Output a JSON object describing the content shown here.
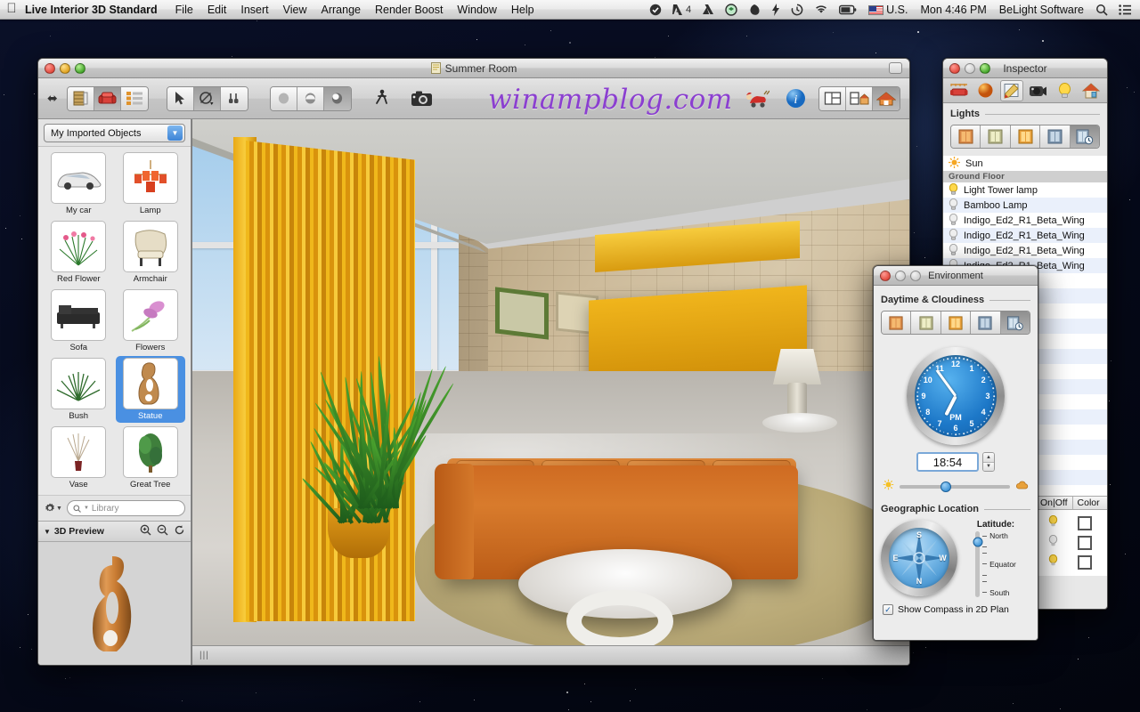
{
  "menubar": {
    "apple_icon": "apple-logo",
    "app_name": "Live Interior 3D Standard",
    "items": [
      "File",
      "Edit",
      "Insert",
      "View",
      "Arrange",
      "Render Boost",
      "Window",
      "Help"
    ],
    "status_icons": [
      "checkmark-circle-icon",
      "adobe-icon",
      "google-drive-icon",
      "dropbox-icon",
      "evernote-icon",
      "flash-icon",
      "time-machine-icon",
      "wifi-icon",
      "battery-icon"
    ],
    "adobe_badge": "4",
    "input_locale": "U.S.",
    "clock": "Mon 4:46 PM",
    "user": "BeLight Software",
    "search_icon": "search-icon",
    "notification_icon": "notification-center-icon"
  },
  "main_window": {
    "title": "Summer Room",
    "title_icon": "document-icon",
    "watermark": "winampblog.com",
    "toolbar": {
      "resize_icon": "left-right-arrow-icon",
      "group_view": [
        {
          "name": "elevation-view-button",
          "icon": "bookcase-icon",
          "active": false
        },
        {
          "name": "furniture-view-button",
          "icon": "armchair-icon",
          "active": true
        },
        {
          "name": "list-view-button",
          "icon": "list-icon",
          "active": false
        }
      ],
      "group_tools": [
        {
          "name": "select-tool",
          "icon": "arrow-cursor-icon",
          "active": false
        },
        {
          "name": "rotate-tool",
          "icon": "rotate-icon",
          "active": true
        },
        {
          "name": "measure-tool",
          "icon": "measure-icon",
          "active": false
        }
      ],
      "group_render": [
        {
          "name": "flat-render-button",
          "icon": "flat-sphere-icon",
          "active": false
        },
        {
          "name": "shaded-render-button",
          "icon": "half-sphere-icon",
          "active": false
        },
        {
          "name": "realistic-render-button",
          "icon": "shaded-sphere-icon",
          "active": true
        }
      ],
      "walk_button": {
        "name": "walkthrough-button",
        "icon": "walking-person-icon"
      },
      "camera_button": {
        "name": "camera-button",
        "icon": "camera-icon"
      },
      "santa_button": {
        "name": "santa-button",
        "icon": "santa-sleigh-icon"
      },
      "info_button": {
        "name": "info-button",
        "icon": "info-circle-icon"
      },
      "group_layout": [
        {
          "name": "plan-view-button",
          "icon": "plan-layout-icon",
          "active": false
        },
        {
          "name": "split-view-button",
          "icon": "split-layout-icon",
          "active": false
        },
        {
          "name": "3d-view-button",
          "icon": "house-icon",
          "active": true
        }
      ]
    },
    "status_grip": "|||"
  },
  "sidebar": {
    "library_popup": "My Imported Objects",
    "objects": [
      {
        "label": "My car",
        "icon": "car-thumb",
        "selected": false
      },
      {
        "label": "Lamp",
        "icon": "chandelier-thumb",
        "selected": false
      },
      {
        "label": "Red Flower",
        "icon": "red-flower-thumb",
        "selected": false
      },
      {
        "label": "Armchair",
        "icon": "armchair-thumb",
        "selected": false
      },
      {
        "label": "Sofa",
        "icon": "sofa-thumb",
        "selected": false
      },
      {
        "label": "Flowers",
        "icon": "flowers-thumb",
        "selected": false
      },
      {
        "label": "Bush",
        "icon": "bush-thumb",
        "selected": false
      },
      {
        "label": "Statue",
        "icon": "statue-thumb",
        "selected": true
      },
      {
        "label": "Vase",
        "icon": "vase-thumb",
        "selected": false
      },
      {
        "label": "Great Tree",
        "icon": "tree-thumb",
        "selected": false
      }
    ],
    "gear_icon": "gear-icon",
    "search_placeholder": "Library",
    "search_icon": "search-icon",
    "preview": {
      "title": "3D Preview",
      "disclosure_icon": "disclosure-triangle-icon",
      "zoom_in_icon": "zoom-in-icon",
      "zoom_out_icon": "zoom-out-icon",
      "rotate_icon": "rotate-refresh-icon",
      "object_icon": "statue-preview"
    }
  },
  "inspector": {
    "title": "Inspector",
    "tabs": [
      {
        "name": "object-tab",
        "icon": "sofa-ruler-icon",
        "active": false
      },
      {
        "name": "material-tab",
        "icon": "orange-sphere-icon",
        "active": false
      },
      {
        "name": "edit-tab",
        "icon": "pencil-pad-icon",
        "active": true
      },
      {
        "name": "camera-tab",
        "icon": "camera-icon",
        "active": false
      },
      {
        "name": "light-tab",
        "icon": "light-bulb-icon",
        "active": false
      },
      {
        "name": "site-tab",
        "icon": "house-icon",
        "active": false
      }
    ],
    "section_title": "Lights",
    "light_modes": [
      {
        "name": "night-mode-button",
        "icon": "window-dark-icon",
        "active": false
      },
      {
        "name": "dawn-mode-button",
        "icon": "window-pale-icon",
        "active": false
      },
      {
        "name": "day-mode-button",
        "icon": "window-bright-icon",
        "active": false
      },
      {
        "name": "artificial-mode-button",
        "icon": "window-blue-icon",
        "active": false
      },
      {
        "name": "custom-time-mode-button",
        "icon": "window-clock-icon",
        "active": true
      }
    ],
    "lights": [
      {
        "name": "Sun",
        "icon": "sun-icon",
        "type": "item"
      },
      {
        "name": "Ground Floor",
        "type": "group"
      },
      {
        "name": "Light Tower lamp",
        "icon": "bulb-on-icon",
        "type": "item"
      },
      {
        "name": "Bamboo Lamp",
        "icon": "bulb-off-icon",
        "type": "item"
      },
      {
        "name": "Indigo_Ed2_R1_Beta_Wing",
        "icon": "bulb-off-icon",
        "type": "item"
      },
      {
        "name": "Indigo_Ed2_R1_Beta_Wing",
        "icon": "bulb-off-icon",
        "type": "item"
      },
      {
        "name": "Indigo_Ed2_R1_Beta_Wing",
        "icon": "bulb-off-icon",
        "type": "item"
      },
      {
        "name": "Indigo_Ed2_R1_Beta_Wing",
        "icon": "bulb-off-icon",
        "type": "item"
      }
    ],
    "table_headers": [
      "On|Off",
      "Color"
    ],
    "table_rows": [
      {
        "on_icon": "bulb-on-icon",
        "color": "#ffffff"
      },
      {
        "on_icon": "bulb-off-icon",
        "color": "#ffffff"
      },
      {
        "on_icon": "bulb-on-icon",
        "color": "#ffffff"
      }
    ]
  },
  "environment": {
    "title": "Environment",
    "daytime_title": "Daytime & Cloudiness",
    "modes": [
      {
        "name": "env-night-button",
        "icon": "window-dark-icon",
        "active": false
      },
      {
        "name": "env-dawn-button",
        "icon": "window-pale-icon",
        "active": false
      },
      {
        "name": "env-day-button",
        "icon": "window-bright-icon",
        "active": false
      },
      {
        "name": "env-artificial-button",
        "icon": "window-blue-icon",
        "active": false
      },
      {
        "name": "env-custom-button",
        "icon": "window-clock-icon",
        "active": true
      }
    ],
    "clock": {
      "numbers": [
        "12",
        "1",
        "2",
        "3",
        "4",
        "5",
        "6",
        "7",
        "8",
        "9",
        "10",
        "11"
      ],
      "meridiem": "PM",
      "hour_angle": 207,
      "minute_angle": 324
    },
    "time_value": "18:54",
    "stepper_up_icon": "stepper-up-icon",
    "stepper_down_icon": "stepper-down-icon",
    "cloudiness": {
      "sun_icon": "sun-small-icon",
      "cloud_icon": "cloud-small-icon",
      "value_pct": 42
    },
    "geo_title": "Geographic Location",
    "compass_letters": [
      "N",
      "E",
      "S",
      "W"
    ],
    "latitude_title": "Latitude:",
    "latitude_ticks": [
      "North",
      "",
      "",
      "Equator",
      "",
      "",
      "South"
    ],
    "latitude_value_pct": 16,
    "show_compass_label": "Show Compass in 2D Plan",
    "show_compass_checked": true,
    "check_glyph": "✓"
  },
  "colors": {
    "accent_blue": "#4a90e2",
    "curtain_gold": "#e9a815",
    "sofa_orange": "#d87b2c",
    "stone_wall": "#c2ae8d",
    "watermark_purple": "#8b3fd0"
  }
}
